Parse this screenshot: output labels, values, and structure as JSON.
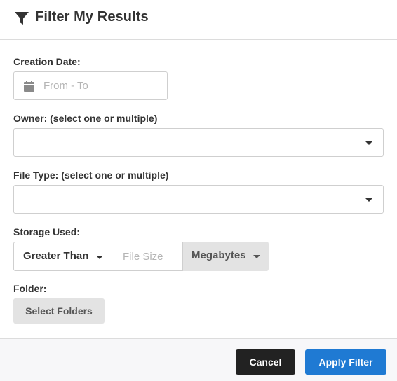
{
  "header": {
    "title": "Filter My Results",
    "icon": "filter-icon"
  },
  "creation_date": {
    "label": "Creation Date:",
    "placeholder": "From - To",
    "value": "",
    "icon": "calendar-icon"
  },
  "owner": {
    "label": "Owner: (select one or multiple)",
    "value": ""
  },
  "file_type": {
    "label": "File Type: (select one or multiple)",
    "value": ""
  },
  "storage": {
    "label": "Storage Used:",
    "operator": "Greater Than",
    "size_placeholder": "File Size",
    "size_value": "",
    "unit": "Megabytes"
  },
  "folder": {
    "label": "Folder:",
    "button_label": "Select Folders"
  },
  "footer": {
    "cancel_label": "Cancel",
    "apply_label": "Apply Filter"
  },
  "colors": {
    "primary": "#1f7ad3",
    "dark_button": "#222222",
    "secondary_button": "#e3e3e3"
  }
}
